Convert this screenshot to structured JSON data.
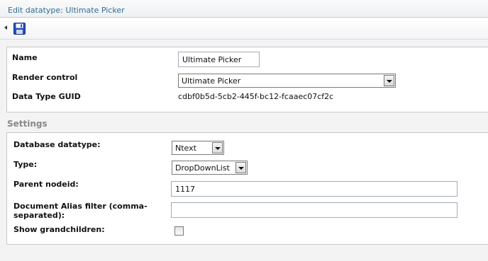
{
  "window": {
    "title": "Edit datatype: Ultimate Picker"
  },
  "toolbar": {
    "collapse_icon": "collapse-left-arrow",
    "save_icon": "floppy-disk"
  },
  "general": {
    "name_label": "Name",
    "name_value": "Ultimate Picker",
    "render_label": "Render control",
    "render_value": "Ultimate Picker",
    "guid_label": "Data Type GUID",
    "guid_value": "cdbf0b5d-5cb2-445f-bc12-fcaaec07cf2c"
  },
  "settings": {
    "heading": "Settings",
    "db_label": "Database datatype:",
    "db_value": "Ntext",
    "type_label": "Type:",
    "type_value": "DropDownList",
    "parent_label": "Parent nodeid:",
    "parent_value": "1117",
    "alias_label": "Document Alias filter (comma-separated):",
    "alias_value": "",
    "grand_label": "Show grandchildren:",
    "grand_checked": false
  },
  "colors": {
    "title": "#2f6f93",
    "panel_bg": "#f3f3f3",
    "heading": "#888888"
  }
}
